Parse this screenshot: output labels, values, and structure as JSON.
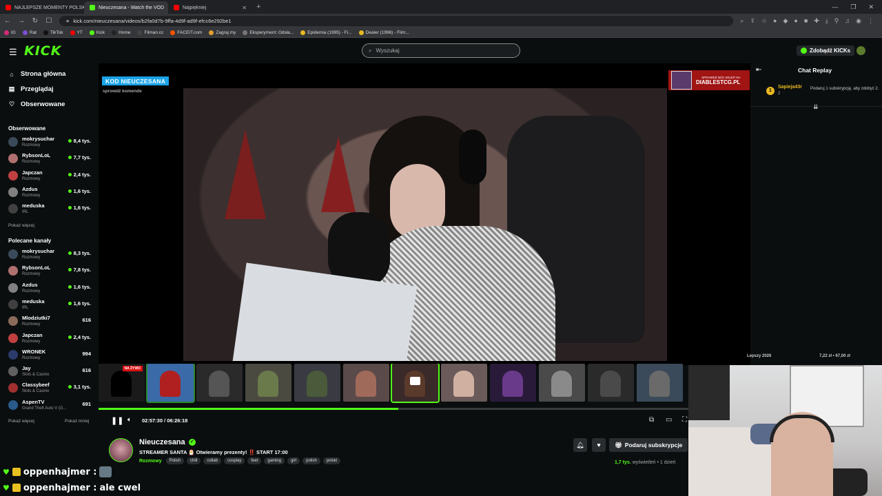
{
  "browser": {
    "tabs": [
      {
        "label": "NAJLEPSZE MOMENTY POLSKIEGO T",
        "color": "#ff0000",
        "active": false
      },
      {
        "label": "Nieuczesana - Watch the VOD",
        "color": "#53fc18",
        "active": true
      },
      {
        "label": "Najpiękniej",
        "color": "#ff0000",
        "active": false
      }
    ],
    "new_tab": "+",
    "url": "kick.com/nieuczesana/videos/b2fa0d7b-9ffa-4d9f-ad9f-efcc6e292be1",
    "bookmarks": [
      {
        "label": "IG",
        "color": "#d62976"
      },
      {
        "label": "Rat",
        "color": "#7b4fd6"
      },
      {
        "label": "TikTok",
        "color": "#111111"
      },
      {
        "label": "YT",
        "color": "#ff0000"
      },
      {
        "label": "Kick",
        "color": "#53fc18"
      },
      {
        "label": "Home",
        "color": "#222222"
      },
      {
        "label": "Filman.cc",
        "color": "#444444"
      },
      {
        "label": "FACEIT.com",
        "color": "#ff5500"
      },
      {
        "label": "Zagraj.my",
        "color": "#e0a030"
      },
      {
        "label": "Eksperyment: Odsła...",
        "color": "#777777"
      },
      {
        "label": "Epidemia (1995) - Fi...",
        "color": "#e8b820"
      },
      {
        "label": "Dealer (1996) - Film...",
        "color": "#e8b820"
      }
    ]
  },
  "header": {
    "logo": "KICK",
    "search_placeholder": "Wyszukaj",
    "get_kicks": "Zdobądź KICKs"
  },
  "sidebar": {
    "nav": [
      {
        "label": "Strona główna",
        "icon": "home-icon",
        "glyph": "⌂"
      },
      {
        "label": "Przeglądaj",
        "icon": "browse-icon",
        "glyph": "▤"
      },
      {
        "label": "Obserwowane",
        "icon": "heart-icon",
        "glyph": "♡"
      }
    ],
    "followed_heading": "Obserwowane",
    "followed": [
      {
        "name": "mokrysuchar",
        "category": "Rozmowy",
        "viewers": "8,4 tys.",
        "color": "#3a4a5a"
      },
      {
        "name": "RybsonLoL",
        "category": "Rozmowy",
        "viewers": "7,7 tys.",
        "color": "#b07070"
      },
      {
        "name": "Japczan",
        "category": "Rozmowy",
        "viewers": "2,4 tys.",
        "color": "#c04040"
      },
      {
        "name": "Azdus",
        "category": "Rozmowy",
        "viewers": "1,6 tys.",
        "color": "#808080"
      },
      {
        "name": "meduska",
        "category": "IRL",
        "viewers": "1,6 tys.",
        "color": "#404040"
      }
    ],
    "show_more_1": "Pokaż więcej",
    "recommended_heading": "Polecane kanały",
    "recommended": [
      {
        "name": "mokrysuchar",
        "category": "Rozmowy",
        "viewers": "8,3 tys.",
        "color": "#3a4a5a",
        "live": true
      },
      {
        "name": "RybsonLoL",
        "category": "Rozmowy",
        "viewers": "7,8 tys.",
        "color": "#b07070",
        "live": true
      },
      {
        "name": "Azdus",
        "category": "Rozmowy",
        "viewers": "1,6 tys.",
        "color": "#808080",
        "live": true
      },
      {
        "name": "meduska",
        "category": "IRL",
        "viewers": "1,6 tys.",
        "color": "#404040",
        "live": true
      },
      {
        "name": "Mlodziutki7",
        "category": "Rozmowy",
        "viewers": "616",
        "color": "#8a6a5a",
        "live": false
      },
      {
        "name": "Japczan",
        "category": "Rozmowy",
        "viewers": "2,4 tys.",
        "color": "#c04040",
        "live": true
      },
      {
        "name": "WRONEK",
        "category": "Rozmowy",
        "viewers": "994",
        "color": "#2a3a6a",
        "live": false
      },
      {
        "name": "Jay",
        "category": "Slots & Casino",
        "viewers": "616",
        "color": "#606060",
        "live": false
      },
      {
        "name": "Classybeef",
        "category": "Slots & Casino",
        "viewers": "3,1 tys.",
        "color": "#a03030",
        "live": true
      },
      {
        "name": "AspenTV",
        "category": "Grand Theft Auto V (G...",
        "viewers": "691",
        "color": "#2a5a8a",
        "live": false
      }
    ],
    "show_more_2": "Pokaż więcej",
    "show_less": "Pokaż mniej"
  },
  "video": {
    "kod_badge": "KOD NIEUCZESANA",
    "kod_sub": "sprowdź komende",
    "ad_line1": "SPRAWDŹ MÓJ SKLEP NA",
    "ad_line2": "DIABLESTCG.PL",
    "live_label": "NA ŻYWO",
    "thumbs": [
      {
        "color": "#1a1a1a",
        "person": "#000000"
      },
      {
        "color": "#3a6aa8",
        "person": "#b02020"
      },
      {
        "color": "#2a2a2a",
        "person": "#555555"
      },
      {
        "color": "#4a4a40",
        "person": "#6a7a4a"
      },
      {
        "color": "#3a3a42",
        "person": "#4a5a3a"
      },
      {
        "color": "#5a4a4a",
        "person": "#a06a5a"
      },
      {
        "color": "#3a2a2a",
        "person": "#5a3a2a"
      },
      {
        "color": "#6a5a5a",
        "person": "#d0b0a0"
      },
      {
        "color": "#2a1a3a",
        "person": "#6a3a8a"
      },
      {
        "color": "#4a4a4a",
        "person": "#8a8a8a"
      },
      {
        "color": "#2a2a2a",
        "person": "#4a4a4a"
      },
      {
        "color": "#3a4a5a",
        "person": "#6a6a6a"
      }
    ],
    "progress_fraction": 0.508,
    "time": "02:57:30 / 06:26:18"
  },
  "stream": {
    "channel": "Nieuczesana",
    "title": "STREAMER SANTA 🎅 Otwieramy prezenty! ‼️ START 17:00",
    "category": "Rozmowy",
    "tags": [
      "Polish",
      "chill",
      "collab",
      "cosplay",
      "feet",
      "gaming",
      "girl",
      "polish",
      "polski"
    ],
    "subscribe_label": "Podaruj subskrypcje",
    "views_count": "1,7 tys.",
    "views_label": "wyświetleń",
    "ago": "1 dzień"
  },
  "chat": {
    "title": "Chat Replay",
    "message": {
      "badge": "1",
      "user": "Sapieja43r",
      "count": "2",
      "text": "Podaruj 1 subskrypcję, aby zdobyć 2."
    },
    "bottom_left": "Lepszy 2026",
    "bottom_right": "7,22 zł • 67,00 zł"
  },
  "overlay_chat": [
    {
      "user": "oppenhajmer :",
      "message": ""
    },
    {
      "user": "oppenhajmer :",
      "message": "ale cwel"
    }
  ],
  "colors": {
    "accent": "#53fc18",
    "background": "#0b0e0f"
  }
}
